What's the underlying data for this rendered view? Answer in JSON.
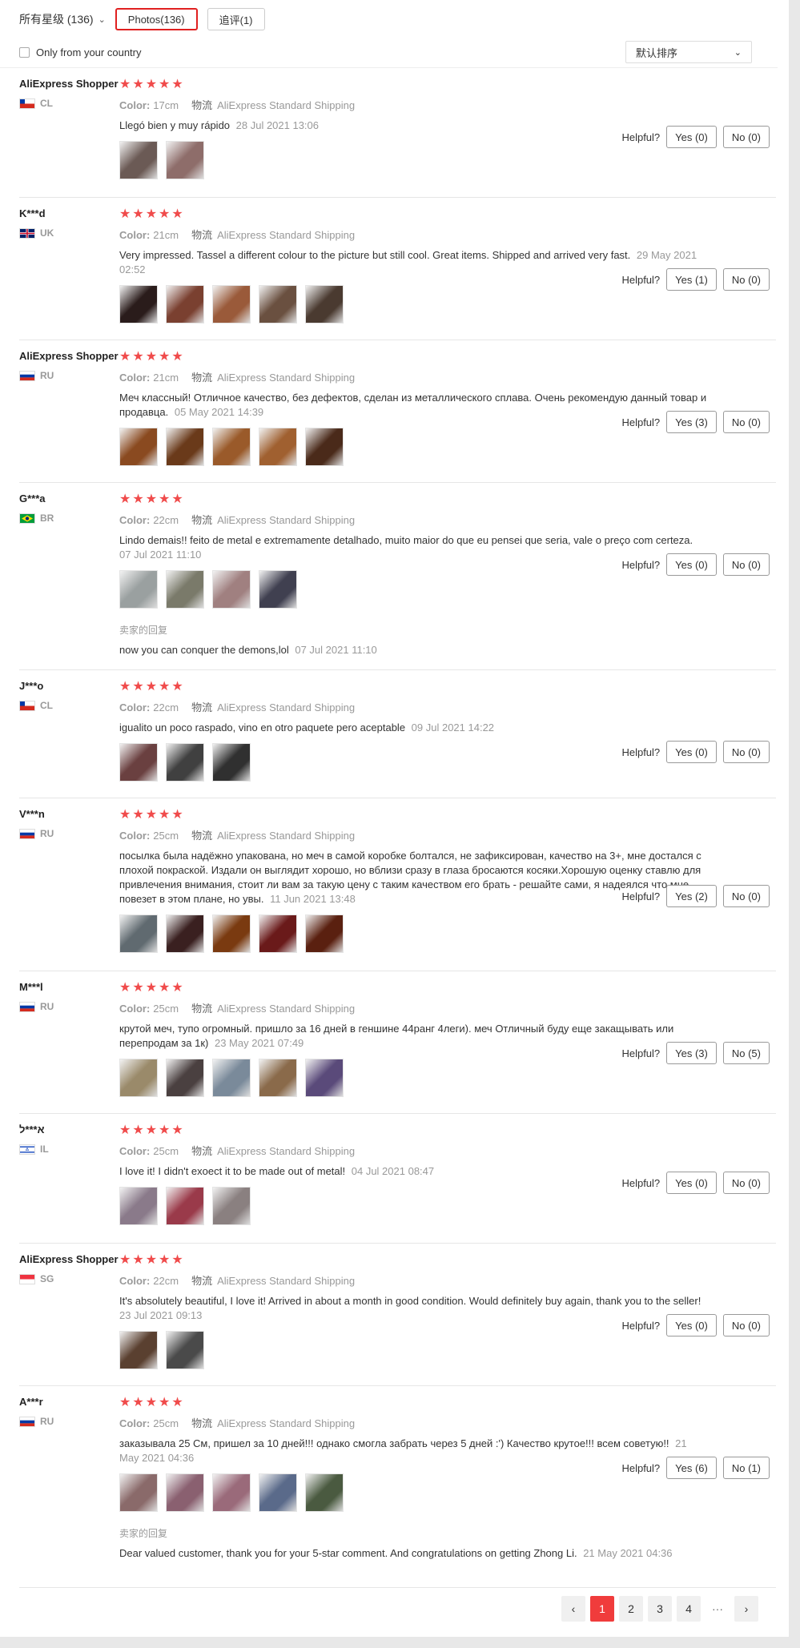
{
  "filters": {
    "stars_label": "所有星级 (136)",
    "photos_tab": "Photos(136)",
    "followup_tab": "追评(1)",
    "country_label": "Only from your country",
    "sort_label": "默认排序"
  },
  "labels": {
    "color": "Color:",
    "logistics": "物流",
    "helpful": "Helpful?",
    "seller_reply": "卖家的回复"
  },
  "stars_glyphs": "★★★★★",
  "reviews": [
    {
      "user": "AliExpress Shopper",
      "country": "CL",
      "flag": "cl",
      "color": "17cm",
      "shipping": "AliExpress Standard Shipping",
      "text": "Llegó bien y muy rápido",
      "date": "28 Jul 2021 13:06",
      "yes": "Yes (0)",
      "no": "No (0)",
      "thumbs": 2
    },
    {
      "user": "K***d",
      "country": "UK",
      "flag": "uk",
      "color": "21cm",
      "shipping": "AliExpress Standard Shipping",
      "text": "Very impressed. Tassel a different colour to the picture but still cool. Great items. Shipped and arrived very fast.",
      "date": "29 May 2021 02:52",
      "yes": "Yes (1)",
      "no": "No (0)",
      "thumbs": 5
    },
    {
      "user": "AliExpress Shopper",
      "country": "RU",
      "flag": "ru",
      "color": "21cm",
      "shipping": "AliExpress Standard Shipping",
      "text": "Меч классный! Отличное качество, без дефектов, сделан из металлического сплава. Очень рекомендую данный товар и продавца.",
      "date": "05 May 2021 14:39",
      "yes": "Yes (3)",
      "no": "No (0)",
      "thumbs": 5
    },
    {
      "user": "G***a",
      "country": "BR",
      "flag": "br",
      "color": "22cm",
      "shipping": "AliExpress Standard Shipping",
      "text": "Lindo demais!! feito de metal e extremamente detalhado, muito maior do que eu pensei que seria, vale o preço com certeza.",
      "date": "07 Jul 2021 11:10",
      "yes": "Yes (0)",
      "no": "No (0)",
      "thumbs": 4,
      "reply": "now you can conquer the demons,lol",
      "reply_date": "07 Jul 2021 11:10"
    },
    {
      "user": "J***o",
      "country": "CL",
      "flag": "cl",
      "color": "22cm",
      "shipping": "AliExpress Standard Shipping",
      "text": "igualito un poco raspado, vino en otro paquete pero aceptable",
      "date": "09 Jul 2021 14:22",
      "yes": "Yes (0)",
      "no": "No (0)",
      "thumbs": 3
    },
    {
      "user": "V***n",
      "country": "RU",
      "flag": "ru",
      "color": "25cm",
      "shipping": "AliExpress Standard Shipping",
      "text": "посылка была надёжно упакована, но меч в самой коробке болтался, не зафиксирован, качество на 3+, мне достался с плохой покраской. Издали он выглядит хорошо, но вблизи сразу в глаза бросаются косяки.Хорошую оценку ставлю для привлечения внимания, стоит ли вам за такую цену с таким качеством его брать - решайте сами, я надеялся что мне повезет в этом плане, но увы.",
      "date": "11 Jun 2021 13:48",
      "yes": "Yes (2)",
      "no": "No (0)",
      "thumbs": 5
    },
    {
      "user": "M***l",
      "country": "RU",
      "flag": "ru",
      "color": "25cm",
      "shipping": "AliExpress Standard Shipping",
      "text": "крутой меч, тупо огромный. пришло за 16 дней в геншине 44ранг 4леги). меч Отличный буду еще закащывать или перепродам за 1к)",
      "date": "23 May 2021 07:49",
      "yes": "Yes (3)",
      "no": "No (5)",
      "thumbs": 5
    },
    {
      "user": "א***ל",
      "country": "IL",
      "flag": "il",
      "color": "25cm",
      "shipping": "AliExpress Standard Shipping",
      "text": "I love it! I didn't exoect it to be made out of metal!",
      "date": "04 Jul 2021 08:47",
      "yes": "Yes (0)",
      "no": "No (0)",
      "thumbs": 3
    },
    {
      "user": "AliExpress Shopper",
      "country": "SG",
      "flag": "sg",
      "color": "22cm",
      "shipping": "AliExpress Standard Shipping",
      "text": "It's absolutely beautiful, I love it! Arrived in about a month in good condition. Would definitely buy again, thank you to the seller!",
      "date": "23 Jul 2021 09:13",
      "yes": "Yes (0)",
      "no": "No (0)",
      "thumbs": 2
    },
    {
      "user": "A***r",
      "country": "RU",
      "flag": "ru",
      "color": "25cm",
      "shipping": "AliExpress Standard Shipping",
      "text": "заказывала 25 См, пришел за 10 дней!!! однако смогла забрать через 5 дней :') Качество крутое!!! всем советую!!",
      "date": "21 May 2021 04:36",
      "yes": "Yes (6)",
      "no": "No (1)",
      "thumbs": 5,
      "reply": "Dear valued customer, thank you for your 5-star comment. And congratulations on getting Zhong Li.",
      "reply_date": "21 May 2021 04:36"
    }
  ],
  "pagination": {
    "prev": "‹",
    "pages": [
      "1",
      "2",
      "3",
      "4"
    ],
    "ellipsis": "···",
    "next": "›",
    "active": "1"
  }
}
